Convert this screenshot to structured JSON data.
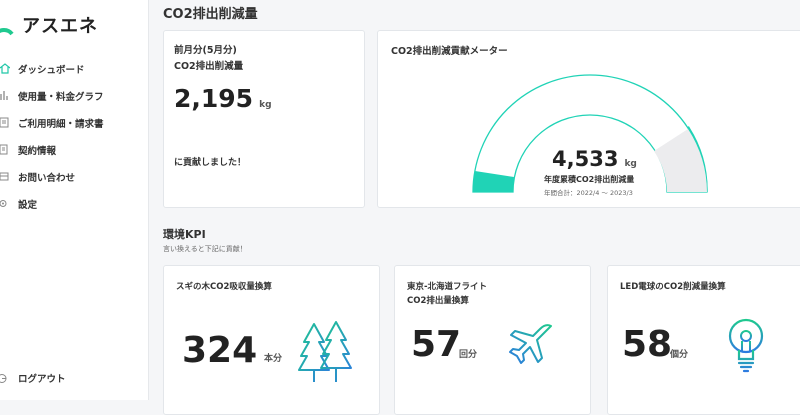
{
  "app": {
    "name": "アスエネ"
  },
  "sidebar": {
    "items": [
      {
        "label": "ダッシュボード",
        "icon": "home-icon"
      },
      {
        "label": "使用量・料金グラフ",
        "icon": "chart-icon"
      },
      {
        "label": "ご利用明細・請求書",
        "icon": "receipt-icon"
      },
      {
        "label": "契約情報",
        "icon": "contract-icon"
      },
      {
        "label": "お問い合わせ",
        "icon": "mail-icon"
      },
      {
        "label": "設定",
        "icon": "settings-icon"
      }
    ],
    "logout": "ログアウト"
  },
  "page": {
    "title": "CO2排出削減量"
  },
  "monthly": {
    "period": "前月分(5月分)",
    "label": "CO2排出削減量",
    "value": "2,195",
    "unit": "kg",
    "note": "に貢献しました！"
  },
  "meter": {
    "title": "CO2排出削減貢献メーター",
    "value": "4,533",
    "unit": "kg",
    "caption": "年度累積CO2排出削減量",
    "period": "年間合計：2022/4 ～ 2023/3",
    "colors": {
      "accent": "#20d3b6",
      "track": "#ececee"
    }
  },
  "kpi": {
    "title": "環境KPI",
    "subtitle": "言い換えると下記に貢献！",
    "cards": [
      {
        "label": "スギの木CO2吸収量換算",
        "value": "324",
        "unit": "本分",
        "icon": "trees-icon"
      },
      {
        "label_line1": "東京-北海道フライト",
        "label_line2": "CO2排出量換算",
        "value": "57",
        "unit": "回分",
        "icon": "airplane-icon"
      },
      {
        "label": "LED電球のCO2削減量換算",
        "value": "58",
        "unit": "個分",
        "icon": "lightbulb-icon"
      }
    ]
  }
}
